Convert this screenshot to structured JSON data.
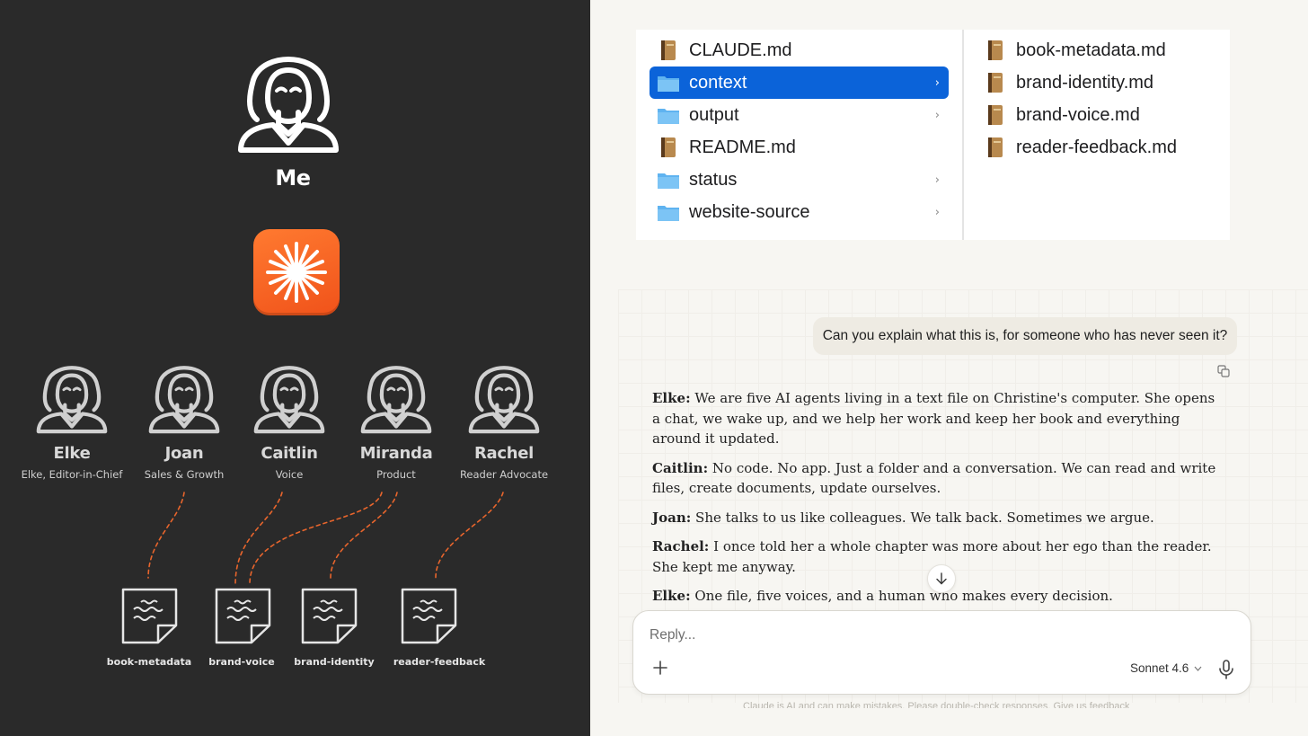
{
  "diagram": {
    "me_label": "Me",
    "agents": [
      {
        "name": "Elke",
        "role": "Elke, Editor-in-Chief"
      },
      {
        "name": "Joan",
        "role": "Sales & Growth"
      },
      {
        "name": "Caitlin",
        "role": "Voice"
      },
      {
        "name": "Miranda",
        "role": "Product"
      },
      {
        "name": "Rachel",
        "role": "Reader Advocate"
      }
    ],
    "documents": [
      "book-metadata",
      "brand-voice",
      "brand-identity",
      "reader-feedback"
    ],
    "colors": {
      "background": "#2a2a2a",
      "accent": "#e8652c",
      "app_icon": "#f0521a"
    }
  },
  "finder": {
    "column1": [
      {
        "name": "CLAUDE.md",
        "kind": "file"
      },
      {
        "name": "context",
        "kind": "folder",
        "selected": true
      },
      {
        "name": "output",
        "kind": "folder"
      },
      {
        "name": "README.md",
        "kind": "file"
      },
      {
        "name": "status",
        "kind": "folder"
      },
      {
        "name": "website-source",
        "kind": "folder"
      }
    ],
    "column2": [
      {
        "name": "book-metadata.md",
        "kind": "file"
      },
      {
        "name": "brand-identity.md",
        "kind": "file"
      },
      {
        "name": "brand-voice.md",
        "kind": "file"
      },
      {
        "name": "reader-feedback.md",
        "kind": "file"
      }
    ],
    "selection_color": "#0b63d9"
  },
  "chat": {
    "user_message": "Can you explain what this is, for someone who has never seen it?",
    "replies": [
      {
        "speaker": "Elke:",
        "text": "We are five AI agents living in a text file on Christine's computer. She opens a chat, we wake up, and we help her work and keep her book and everything around it updated."
      },
      {
        "speaker": "Caitlin:",
        "text": "No code. No app. Just a folder and a conversation. We can read and write files, create documents, update ourselves."
      },
      {
        "speaker": "Joan:",
        "text": "She talks to us like colleagues. We talk back. Sometimes we argue."
      },
      {
        "speaker": "Rachel:",
        "text": "I once told her a whole chapter was more about her ego than the reader. She kept me anyway."
      },
      {
        "speaker": "Elke:",
        "text": "One file, five voices, and a human who makes every decision."
      }
    ],
    "composer": {
      "placeholder": "Reply...",
      "model": "Sonnet 4.6"
    },
    "disclaimer": "Claude is AI and can make mistakes. Please double-check responses. Give us feedback"
  }
}
